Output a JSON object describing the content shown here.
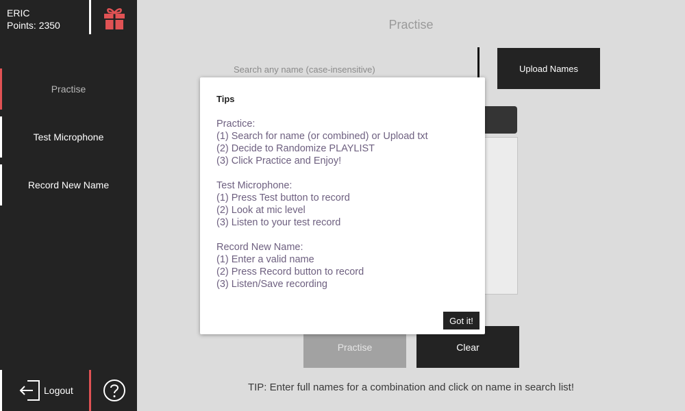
{
  "user": {
    "name": "ERIC",
    "points": "Points: 2350"
  },
  "sidebar": {
    "items": [
      {
        "label": "Practise"
      },
      {
        "label": "Test Microphone"
      },
      {
        "label": "Record New Name"
      }
    ],
    "logout_label": "Logout"
  },
  "icons": {
    "gift": "gift-icon",
    "logout": "logout-icon",
    "help": "help-icon"
  },
  "colors": {
    "accent": "#e05254",
    "dark": "#232323",
    "background": "#dcdcdc"
  },
  "main": {
    "title": "Practise",
    "search_placeholder": "Search any name (case-insensitive)",
    "upload_label": "Upload Names",
    "practise_label": "Practise",
    "clear_label": "Clear",
    "tip": "TIP: Enter full names for a combination and click on name in search list!"
  },
  "modal": {
    "title": "Tips",
    "sections": [
      {
        "heading": "Practice:",
        "steps": [
          "(1) Search for name (or combined) or Upload txt",
          "(2) Decide to Randomize PLAYLIST",
          "(3) Click Practice and Enjoy!"
        ]
      },
      {
        "heading": "Test Microphone:",
        "steps": [
          "(1) Press Test button to record",
          "(2) Look at mic level",
          "(3) Listen to your test record"
        ]
      },
      {
        "heading": "Record New Name:",
        "steps": [
          "(1) Enter a valid name",
          "(2) Press Record button to record",
          "(3) Listen/Save recording"
        ]
      }
    ],
    "button_label": "Got it!"
  }
}
